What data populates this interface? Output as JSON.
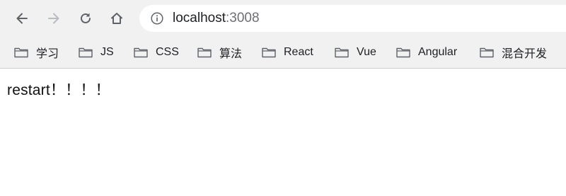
{
  "browser": {
    "address": {
      "host": "localhost",
      "port": ":3008"
    },
    "icons": {
      "back": "back-arrow-icon",
      "forward": "forward-arrow-icon",
      "reload": "reload-icon",
      "home": "home-icon",
      "info": "info-icon",
      "folder": "folder-icon"
    },
    "nav_state": {
      "back_enabled": true,
      "forward_enabled": false
    },
    "bookmarks": [
      {
        "label": "学习"
      },
      {
        "label": "JS"
      },
      {
        "label": "CSS"
      },
      {
        "label": "算法"
      },
      {
        "label": "React"
      },
      {
        "label": "Vue"
      },
      {
        "label": "Angular"
      },
      {
        "label": "混合开发"
      }
    ]
  },
  "page": {
    "text": "restart！！！！"
  },
  "colors": {
    "chrome_bg": "#f1f1f2",
    "icon": "#5f6368",
    "icon_disabled": "#b9bcc0",
    "text": "#202124"
  }
}
